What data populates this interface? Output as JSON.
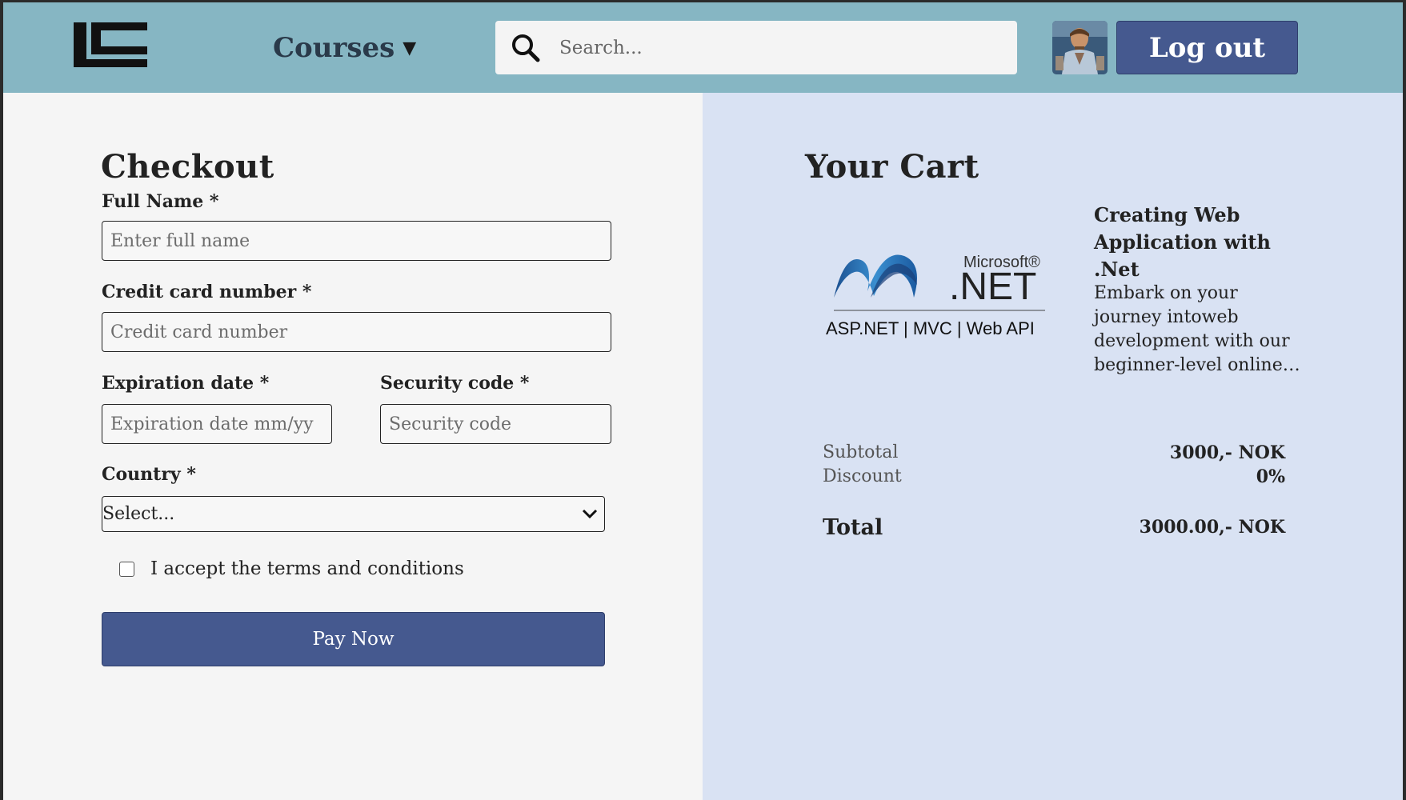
{
  "header": {
    "courses_label": "Courses",
    "search_placeholder": "Search...",
    "logout_label": "Log out"
  },
  "checkout": {
    "title": "Checkout",
    "full_name_label": "Full Name *",
    "full_name_placeholder": "Enter full name",
    "card_label": "Credit card number *",
    "card_placeholder": "Credit card number",
    "expiration_label": "Expiration date *",
    "expiration_placeholder": "Expiration date mm/yy",
    "security_label": "Security code *",
    "security_placeholder": "Security code",
    "country_label": "Country *",
    "country_selected": "Select...",
    "terms_label": "I accept the terms and conditions",
    "pay_label": "Pay Now"
  },
  "cart": {
    "title": "Your Cart",
    "item": {
      "image_text_brand": "Microsoft®",
      "image_text_net": ".NET",
      "image_caption": "ASP.NET | MVC | Web API",
      "title": "Creating Web Application with .Net",
      "description": "Embark on your journey intoweb development with our beginner-level online…"
    },
    "subtotal_label": "Subtotal",
    "subtotal_value": "3000,- NOK",
    "discount_label": "Discount",
    "discount_value": "0%",
    "total_label": "Total",
    "total_value": "3000.00,- NOK"
  },
  "colors": {
    "header_bg": "#86b6c3",
    "button_bg": "#45598f",
    "cart_bg": "#d9e2f3"
  }
}
